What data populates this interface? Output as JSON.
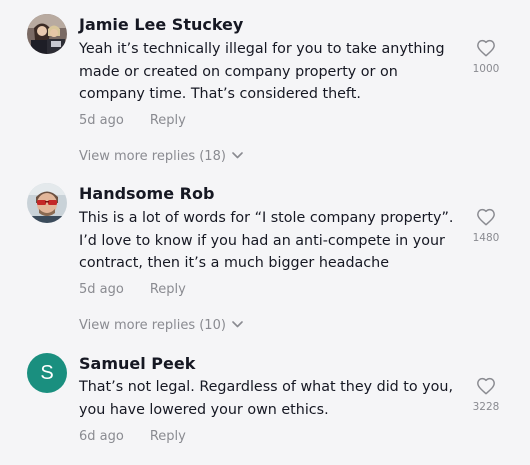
{
  "comments": [
    {
      "username": "Jamie Lee Stuckey",
      "avatar_icon": "profile-photo",
      "lines": [
        "Yeah it’s technically illegal for you to take anything",
        "made or created on company property or on",
        "company time. That’s considered theft."
      ],
      "time": "5d ago",
      "reply_label": "Reply",
      "likes": "1000",
      "more_replies": "View more replies (18)"
    },
    {
      "username": "Handsome Rob",
      "avatar_icon": "profile-photo",
      "lines": [
        "This is a lot of words for “I stole company property”.",
        "I’d love to know if you had an anti-compete in your",
        "contract, then it’s a much bigger headache"
      ],
      "time": "5d ago",
      "reply_label": "Reply",
      "likes": "1480",
      "more_replies": "View more replies (10)"
    },
    {
      "username": "Samuel Peek",
      "avatar_letter": "S",
      "avatar_color": "#1a8f7f",
      "lines": [
        "That’s not legal. Regardless of what they did to you,",
        "you have lowered your own ethics."
      ],
      "time": "6d ago",
      "reply_label": "Reply",
      "likes": "3228"
    }
  ],
  "colors": {
    "background": "#f5f5f7",
    "primary_text": "#161823",
    "secondary_text": "#8a8b91"
  },
  "icons": {
    "like": "heart-outline-icon",
    "expand": "chevron-down-icon"
  }
}
